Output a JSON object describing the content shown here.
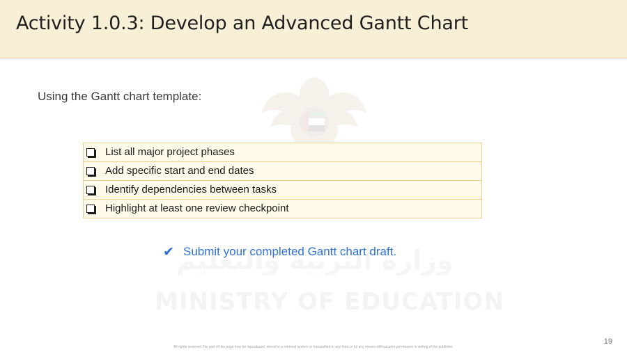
{
  "slide": {
    "title": "Activity 1.0.3: Develop an Advanced Gantt Chart",
    "intro": "Using the Gantt chart template:",
    "checklist": [
      {
        "icon": "checkbox-icon",
        "label": "List all major project phases"
      },
      {
        "icon": "checkbox-icon",
        "label": "Add specific start and end dates"
      },
      {
        "icon": "checkbox-icon",
        "label": "Identify dependencies between tasks"
      },
      {
        "icon": "checkbox-icon",
        "label": "Highlight at least one review checkpoint"
      }
    ],
    "submit": {
      "icon": "checkmark-icon",
      "text": "Submit your completed Gantt chart draft."
    },
    "page_number": "19",
    "footer_notice": "All rights reserved. No part of this page may be reproduced, stored in a retrieval system or transmitted in any form or by any means without prior permission in writing of the publisher."
  },
  "watermark": {
    "emblem": "uae-falcon-emblem",
    "arabic_text": "وزارة التربية والتعليم",
    "english_text": "MINISTRY OF EDUCATION"
  },
  "colors": {
    "header_background": "#f7efd6",
    "header_border": "#e3c3a8",
    "table_border": "#f1cf8d",
    "table_background": "#fffaea",
    "accent_blue": "#2f73d8"
  }
}
